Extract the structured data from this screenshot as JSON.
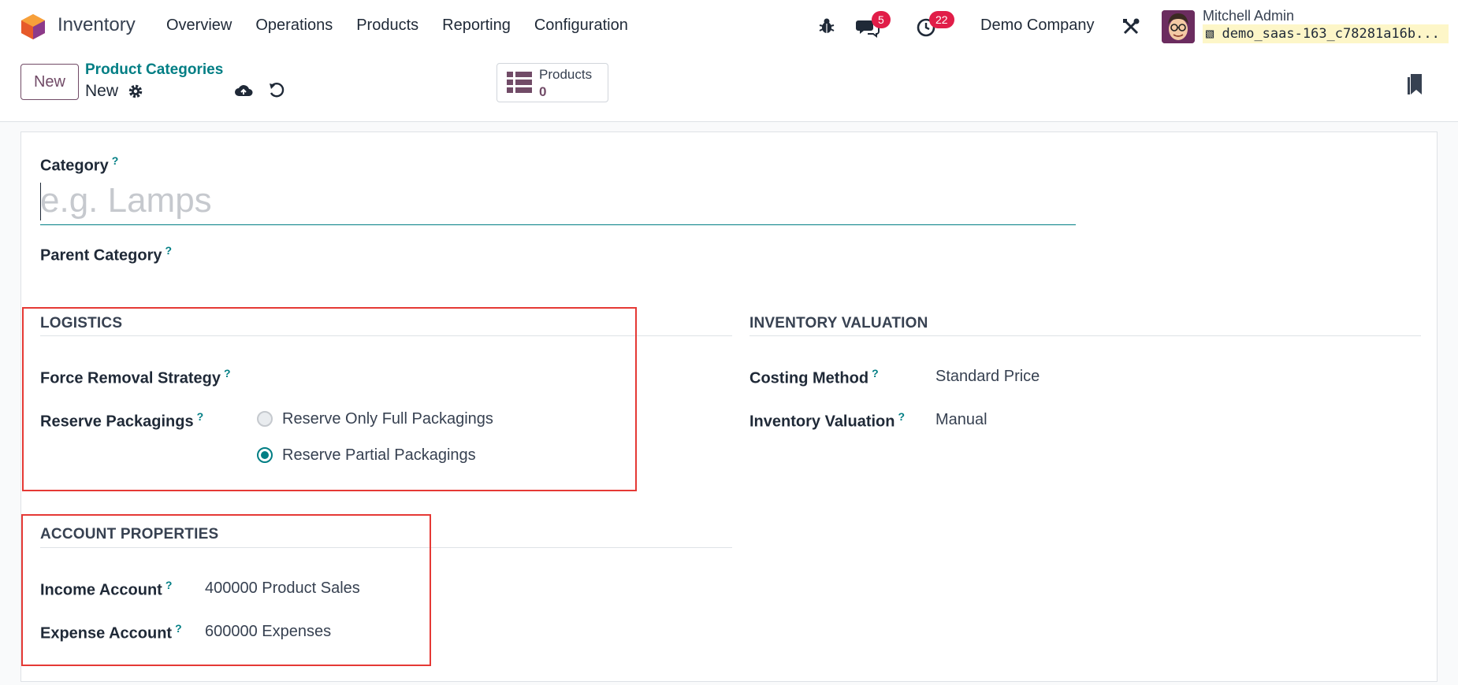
{
  "app": {
    "name": "Inventory"
  },
  "menu": [
    "Overview",
    "Operations",
    "Products",
    "Reporting",
    "Configuration"
  ],
  "systray": {
    "messages_count": "5",
    "activities_count": "22",
    "company": "Demo Company",
    "user_name": "Mitchell Admin",
    "database": "demo_saas-163_c78281a16b..."
  },
  "control": {
    "new_label": "New",
    "breadcrumb_parent": "Product Categories",
    "breadcrumb_current": "New",
    "smart_button": {
      "label": "Products",
      "value": "0"
    }
  },
  "form": {
    "category_label": "Category",
    "category_placeholder": "e.g. Lamps",
    "parent_label": "Parent Category",
    "logistics": {
      "title": "LOGISTICS",
      "removal_label": "Force Removal Strategy",
      "packagings_label": "Reserve Packagings",
      "options": [
        "Reserve Only Full Packagings",
        "Reserve Partial Packagings"
      ],
      "selected": "Reserve Partial Packagings"
    },
    "valuation": {
      "title": "INVENTORY VALUATION",
      "costing_label": "Costing Method",
      "costing_value": "Standard Price",
      "valuation_label": "Inventory Valuation",
      "valuation_value": "Manual"
    },
    "accounts": {
      "title": "ACCOUNT PROPERTIES",
      "income_label": "Income Account",
      "income_value": "400000 Product Sales",
      "expense_label": "Expense Account",
      "expense_value": "600000 Expenses"
    }
  },
  "colors": {
    "primary": "#714b67",
    "accent": "#017e84",
    "badge": "#e11d48",
    "highlight": "#e53935"
  }
}
